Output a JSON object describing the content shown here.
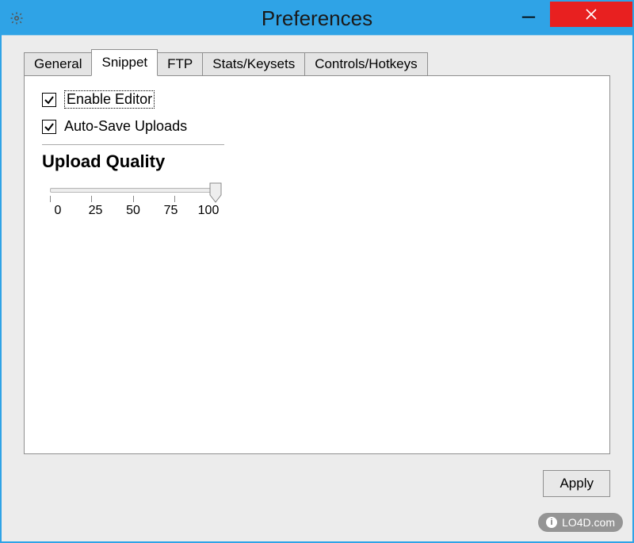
{
  "window": {
    "title": "Preferences"
  },
  "tabs": [
    {
      "label": "General",
      "active": false
    },
    {
      "label": "Snippet",
      "active": true
    },
    {
      "label": "FTP",
      "active": false
    },
    {
      "label": "Stats/Keysets",
      "active": false
    },
    {
      "label": "Controls/Hotkeys",
      "active": false
    }
  ],
  "snippet": {
    "enable_editor": {
      "label": "Enable Editor",
      "checked": true,
      "focused": true
    },
    "auto_save_uploads": {
      "label": "Auto-Save Uploads",
      "checked": true,
      "focused": false
    },
    "section_title": "Upload Quality",
    "slider": {
      "min": 0,
      "max": 100,
      "value": 100,
      "ticks": [
        "0",
        "25",
        "50",
        "75",
        "100"
      ]
    }
  },
  "buttons": {
    "apply": "Apply"
  },
  "watermark": "LO4D.com"
}
